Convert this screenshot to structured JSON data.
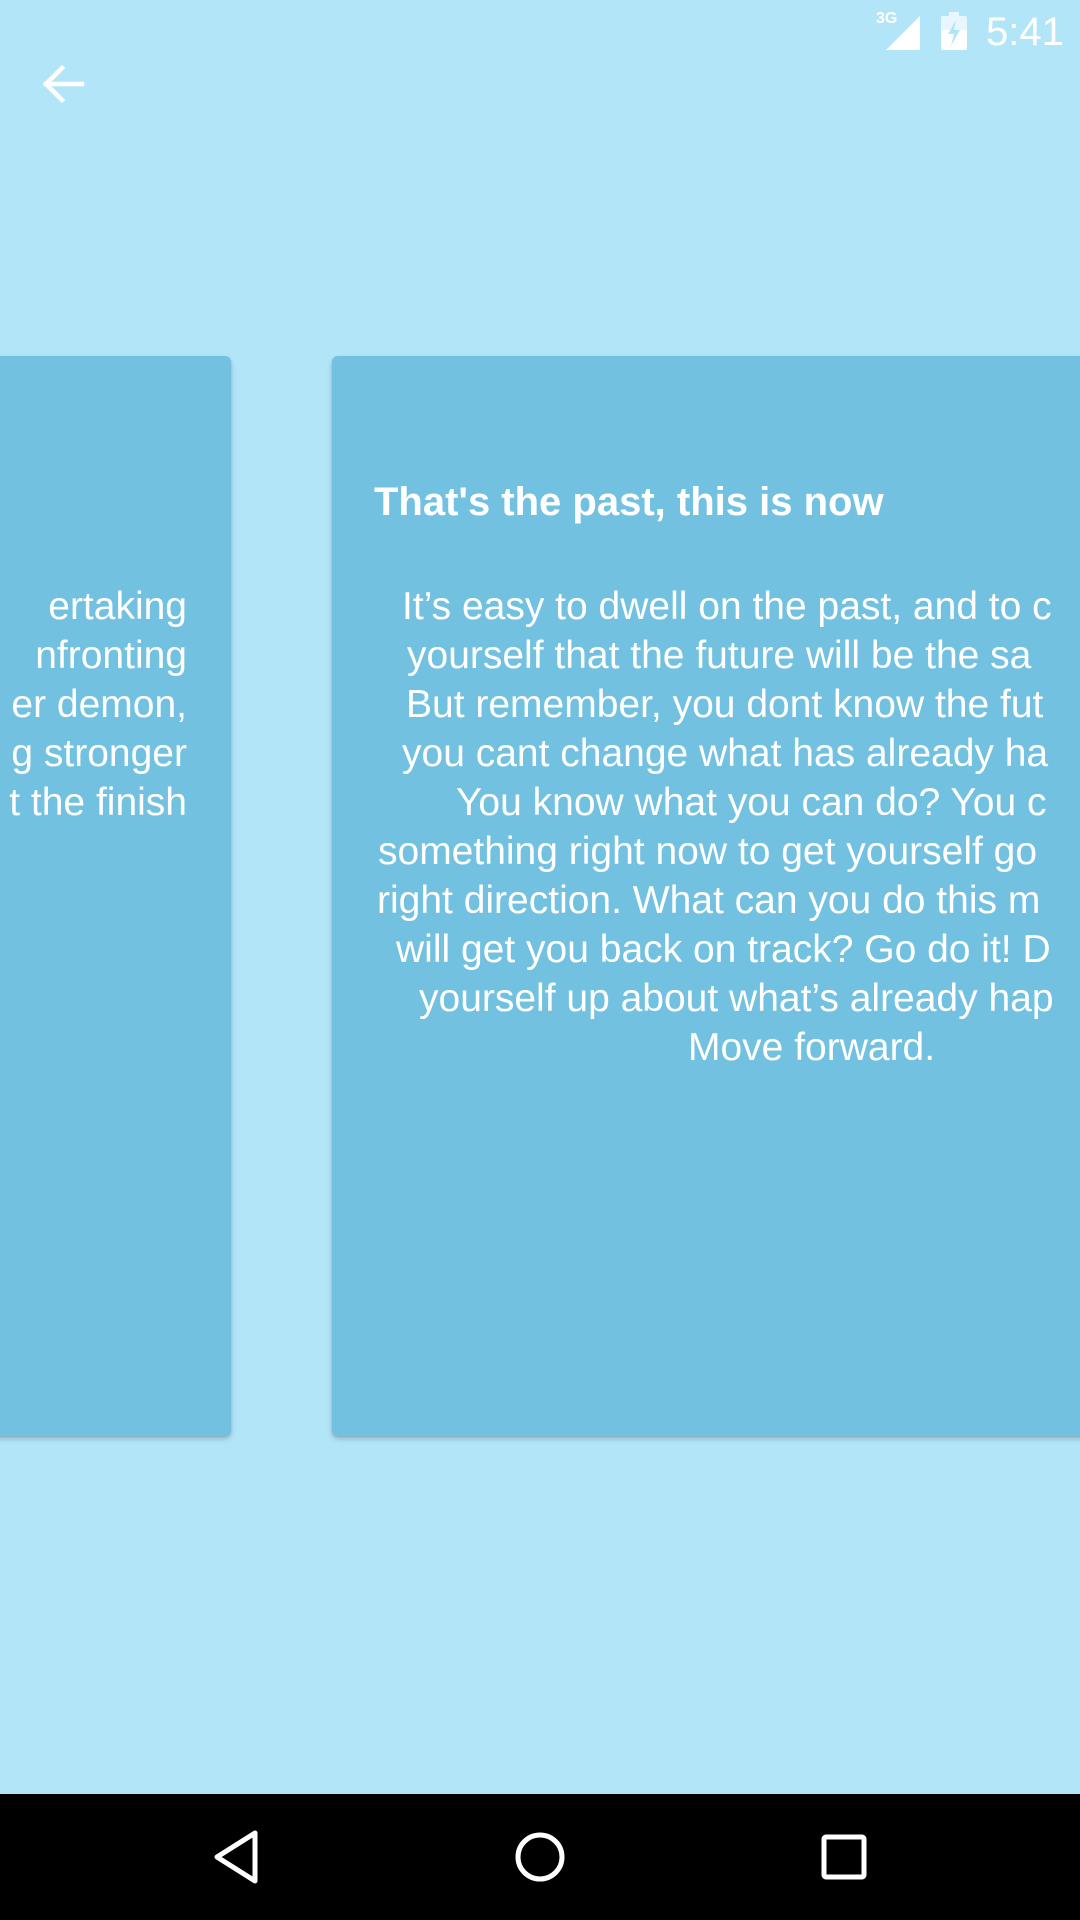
{
  "status_bar": {
    "network_label": "3G",
    "time": "5:41"
  },
  "icons": {
    "back": "arrow-left-icon",
    "signal": "cell-signal-icon",
    "battery": "battery-charging-icon",
    "nav_back": "triangle-back-icon",
    "nav_home": "circle-home-icon",
    "nav_recents": "square-recents-icon"
  },
  "colors": {
    "background": "#b3e5f9",
    "card": "#73c1e1",
    "text": "#ffffff",
    "nav_bar": "#000000"
  },
  "cards": {
    "previous": {
      "lines": [
        "ertaking",
        "nfronting",
        "er demon,",
        "g stronger",
        "t the finish"
      ]
    },
    "current": {
      "title": "That's the past, this is now",
      "lines": [
        "It’s easy to dwell on the past, and to c",
        "yourself that the future will be the sa",
        "But remember, you dont know the fut",
        "you cant change what has already ha",
        "You know what you can do? You c",
        "something right now to get yourself go",
        "right direction. What can you do this m",
        "will get you back on track? Go do it! D",
        "yourself up about what’s already hap",
        "Move forward."
      ]
    }
  }
}
